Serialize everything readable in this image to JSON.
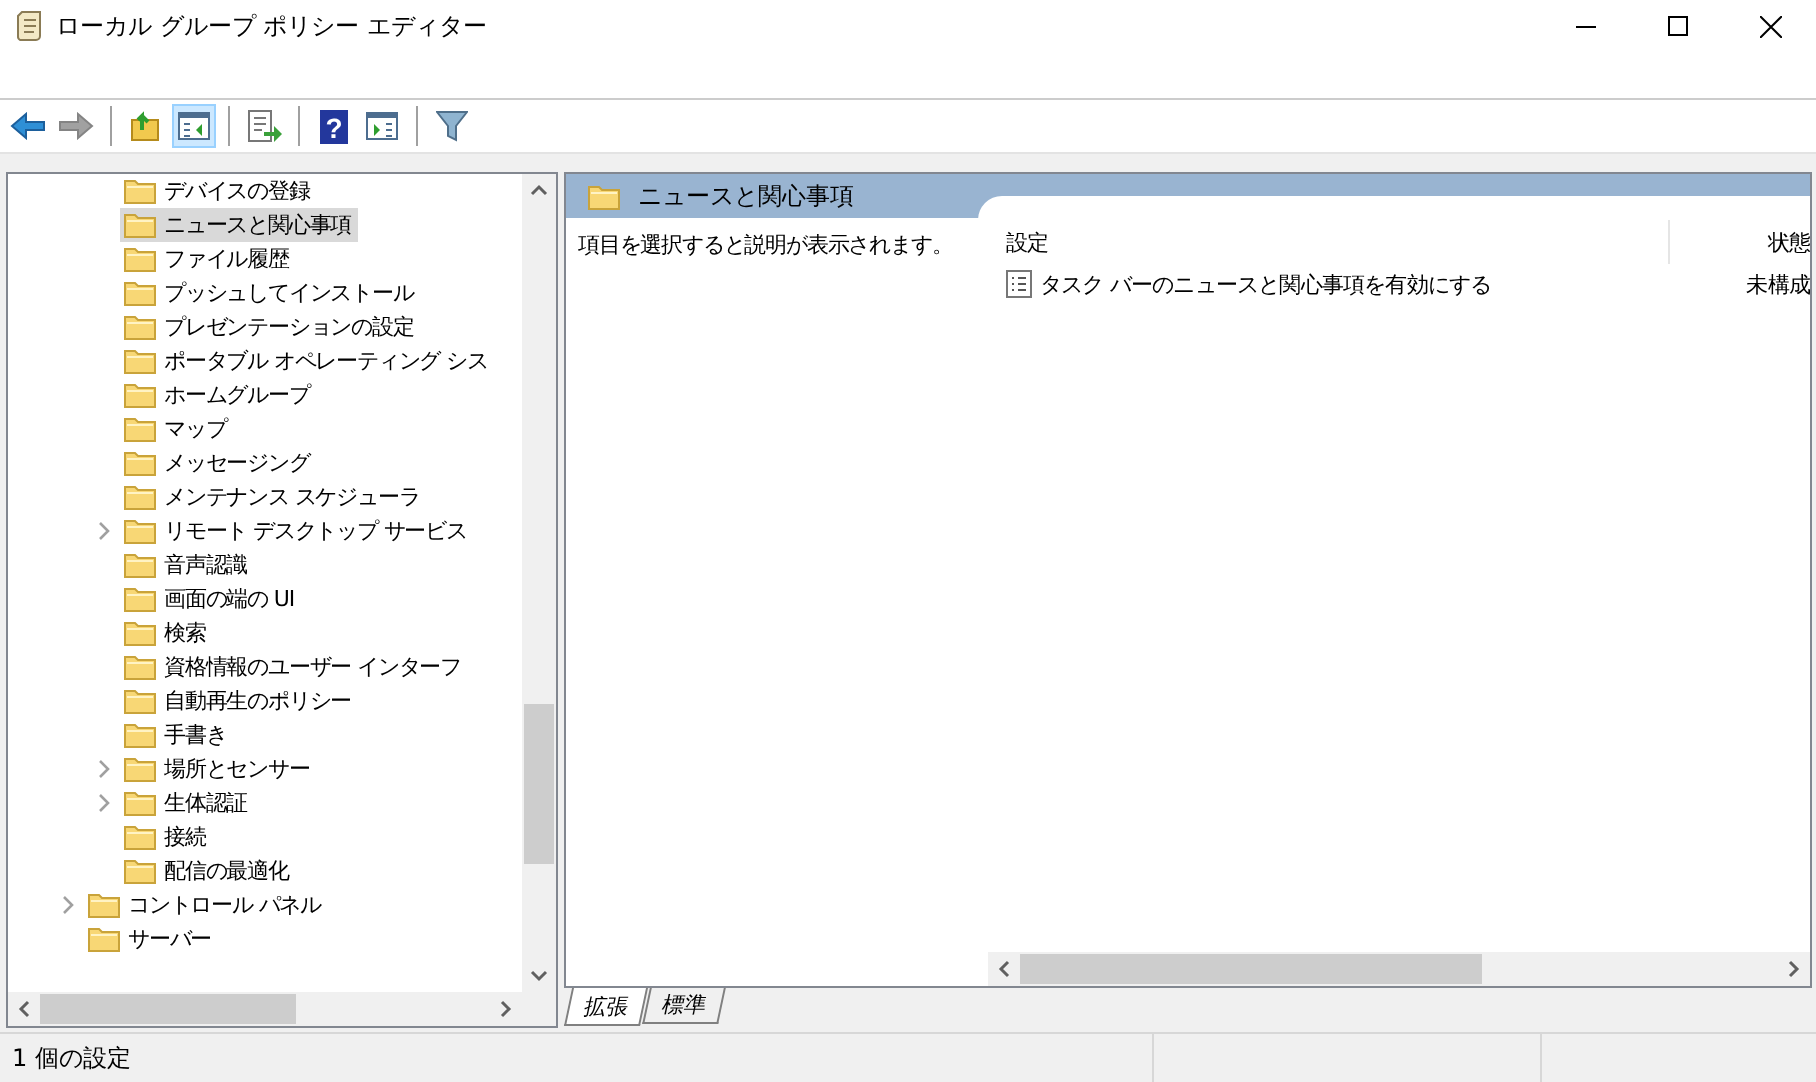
{
  "window": {
    "title": "ローカル グループ ポリシー エディター"
  },
  "toolbar": [
    {
      "kind": "back",
      "pressed": false,
      "disabled": false
    },
    {
      "kind": "forward",
      "pressed": false,
      "disabled": true
    },
    {
      "kind": "separator"
    },
    {
      "kind": "up",
      "pressed": false,
      "disabled": false
    },
    {
      "kind": "tree",
      "pressed": true,
      "disabled": false
    },
    {
      "kind": "separator"
    },
    {
      "kind": "export",
      "pressed": false,
      "disabled": false
    },
    {
      "kind": "separator"
    },
    {
      "kind": "help",
      "glyph": "?",
      "pressed": false,
      "disabled": false
    },
    {
      "kind": "action",
      "pressed": false,
      "disabled": false
    },
    {
      "kind": "separator"
    },
    {
      "kind": "filter",
      "pressed": false,
      "disabled": false
    }
  ],
  "tree": {
    "items": [
      {
        "children": [
          {
            "label": "デバイスの登録",
            "expandable": false,
            "selected": false
          },
          {
            "label": "ニュースと関心事項",
            "expandable": false,
            "selected": true
          },
          {
            "label": "ファイル履歴",
            "expandable": false,
            "selected": false
          },
          {
            "label": "プッシュしてインストール",
            "expandable": false,
            "selected": false
          },
          {
            "label": "プレゼンテーションの設定",
            "expandable": false,
            "selected": false
          },
          {
            "label": "ポータブル オペレーティング シス",
            "expandable": false,
            "selected": false
          },
          {
            "label": "ホームグループ",
            "expandable": false,
            "selected": false
          },
          {
            "label": "マップ",
            "expandable": false,
            "selected": false
          },
          {
            "label": "メッセージング",
            "expandable": false,
            "selected": false
          },
          {
            "label": "メンテナンス スケジューラ",
            "expandable": false,
            "selected": false
          },
          {
            "label": "リモート デスクトップ サービス",
            "expandable": true,
            "selected": false
          },
          {
            "label": "音声認識",
            "expandable": false,
            "selected": false
          },
          {
            "label": "画面の端の UI",
            "expandable": false,
            "selected": false
          },
          {
            "label": "検索",
            "expandable": false,
            "selected": false
          },
          {
            "label": "資格情報のユーザー インターフ",
            "expandable": false,
            "selected": false
          },
          {
            "label": "自動再生のポリシー",
            "expandable": false,
            "selected": false
          },
          {
            "label": "手書き",
            "expandable": false,
            "selected": false
          },
          {
            "label": "場所とセンサー",
            "expandable": true,
            "selected": false
          },
          {
            "label": "生体認証",
            "expandable": true,
            "selected": false
          },
          {
            "label": "接続",
            "expandable": false,
            "selected": false
          },
          {
            "label": "配信の最適化",
            "expandable": false,
            "selected": false
          }
        ]
      },
      {
        "label": "コントロール パネル",
        "expandable": true,
        "selected": false
      },
      {
        "label": "サーバー",
        "expandable": false,
        "selected": false
      }
    ]
  },
  "details": {
    "title": "ニュースと関心事項",
    "description": "項目を選択すると説明が表示されます。",
    "columns": [
      {
        "label": "設定"
      },
      {
        "label": "状態"
      }
    ],
    "rows": [
      {
        "cells": [
          "タスク バーのニュースと関心事項を有効にする",
          "未構成"
        ]
      }
    ],
    "tabs": [
      {
        "label": "拡張",
        "selected": true
      },
      {
        "label": "標準",
        "selected": false
      }
    ]
  },
  "status_bar": {
    "text": "1 個の設定"
  }
}
